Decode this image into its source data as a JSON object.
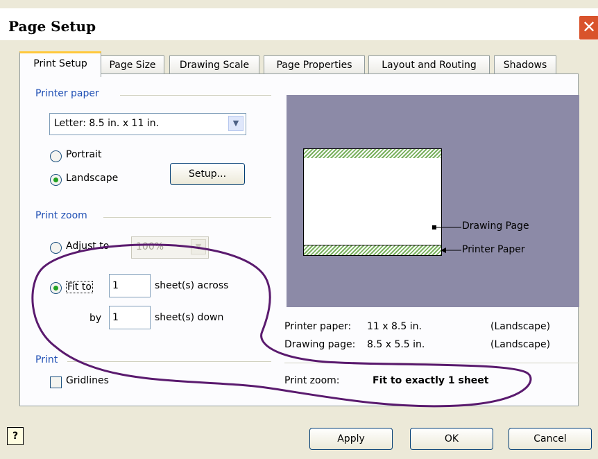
{
  "window": {
    "title": "Page Setup",
    "close_glyph": "✕"
  },
  "tabs": [
    "Print Setup",
    "Page Size",
    "Drawing Scale",
    "Page Properties",
    "Layout and Routing",
    "Shadows"
  ],
  "printer_paper": {
    "heading": "Printer paper",
    "paper_select": "Letter:  8.5 in. x 11 in.",
    "portrait_label": "Portrait",
    "landscape_label": "Landscape",
    "orientation_selected": "Landscape",
    "setup_button": "Setup..."
  },
  "print_zoom": {
    "heading": "Print zoom",
    "adjust_label": "Adjust to",
    "adjust_value": "100%",
    "fit_label": "Fit to",
    "across_value": "1",
    "across_label": "sheet(s) across",
    "by_label": "by",
    "down_value": "1",
    "down_label": "sheet(s) down",
    "selected": "Fit to"
  },
  "print": {
    "heading": "Print",
    "gridlines_label": "Gridlines",
    "gridlines_checked": false
  },
  "preview": {
    "drawing_page_label": "Drawing Page",
    "printer_paper_label": "Printer Paper",
    "background_color": "#8c8aa7",
    "annotation_color": "#5a1a6e"
  },
  "info": {
    "printer_paper_label": "Printer paper:",
    "printer_paper_size": "11 x 8.5 in.",
    "printer_paper_orient": "(Landscape)",
    "drawing_page_label": "Drawing page:",
    "drawing_page_size": "8.5 x 5.5 in.",
    "drawing_page_orient": "(Landscape)",
    "print_zoom_label": "Print zoom:",
    "print_zoom_value": "Fit to exactly 1 sheet"
  },
  "footer": {
    "help_glyph": "?",
    "apply": "Apply",
    "ok": "OK",
    "cancel": "Cancel"
  }
}
